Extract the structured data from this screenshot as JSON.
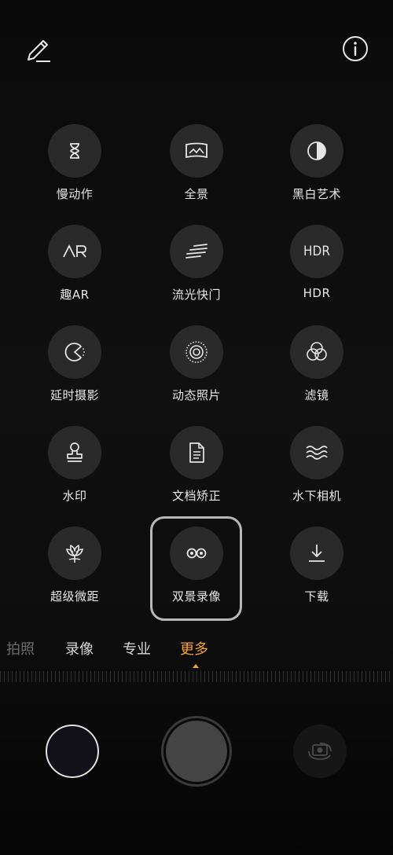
{
  "top_bar": {
    "edit_icon": "pencil-icon",
    "info_icon": "info-icon"
  },
  "modes": [
    {
      "label": "慢动作",
      "icon": "hourglass-icon"
    },
    {
      "label": "全景",
      "icon": "panorama-icon"
    },
    {
      "label": "黑白艺术",
      "icon": "half-circle-icon"
    },
    {
      "label": "趣AR",
      "icon": "ar-icon"
    },
    {
      "label": "流光快门",
      "icon": "light-streak-icon"
    },
    {
      "label": "HDR",
      "icon": "hdr-icon"
    },
    {
      "label": "延时摄影",
      "icon": "timelapse-icon"
    },
    {
      "label": "动态照片",
      "icon": "moving-photo-icon"
    },
    {
      "label": "滤镜",
      "icon": "filter-icon"
    },
    {
      "label": "水印",
      "icon": "stamp-icon"
    },
    {
      "label": "文档矫正",
      "icon": "document-icon"
    },
    {
      "label": "水下相机",
      "icon": "waves-icon"
    },
    {
      "label": "超级微距",
      "icon": "flower-icon"
    },
    {
      "label": "双景录像",
      "icon": "dual-view-icon",
      "selected": true
    },
    {
      "label": "下载",
      "icon": "download-icon"
    }
  ],
  "mode_tabs": [
    {
      "label": "拍照",
      "state": "faded"
    },
    {
      "label": "录像",
      "state": "normal"
    },
    {
      "label": "专业",
      "state": "normal"
    },
    {
      "label": "更多",
      "state": "active"
    }
  ],
  "colors": {
    "accent": "#f2a33a",
    "background": "#000000",
    "mode_circle": "#2a2a2a"
  },
  "hdr_icon_text": "HDR"
}
